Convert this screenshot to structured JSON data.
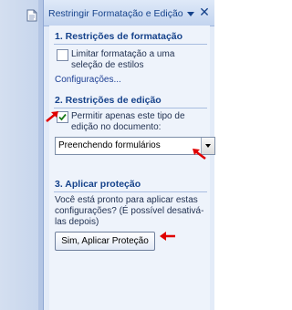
{
  "taskpane": {
    "title": "Restringir Formatação e Edição",
    "dropdown_icon": "dropdown-arrow-icon",
    "close_symbol": "✕"
  },
  "sections": {
    "formatting": {
      "title": "1. Restrições de formatação",
      "checkbox_label": "Limitar formatação a uma seleção de estilos",
      "checkbox_checked": false,
      "link_label": "Configurações..."
    },
    "editing": {
      "title": "2. Restrições de edição",
      "checkbox_label": "Permitir apenas este tipo de edição no documento:",
      "checkbox_checked": true,
      "select_value": "Preenchendo formulários"
    },
    "apply": {
      "title": "3. Aplicar proteção",
      "description": "Você está pronto para aplicar estas configurações? (É possível desativá-las depois)",
      "button_label": "Sim, Aplicar Proteção"
    }
  },
  "colors": {
    "accent": "#15428b",
    "annotation_arrow": "#e00000"
  }
}
